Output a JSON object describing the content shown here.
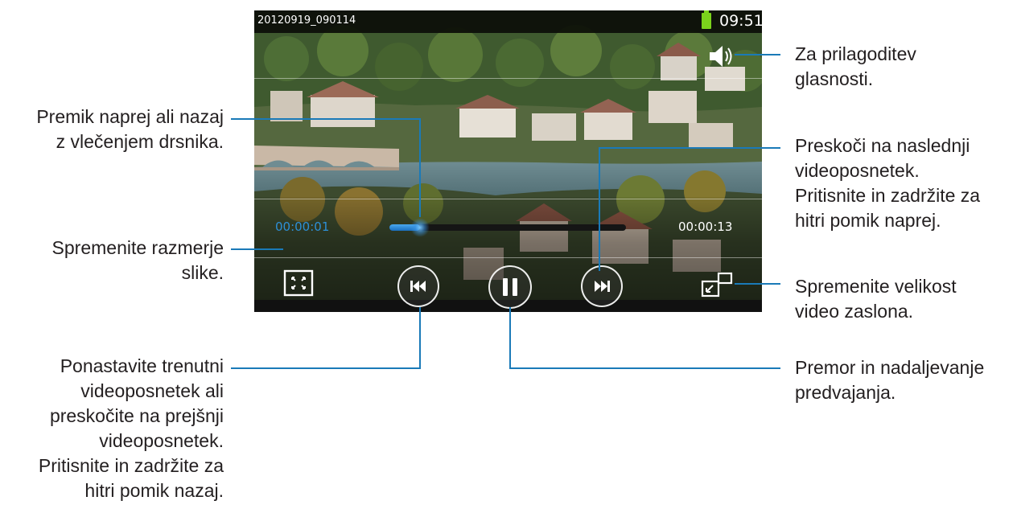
{
  "status_bar": {
    "file_name": "20120919_090114",
    "time": "09:51"
  },
  "player": {
    "current_time": "00:00:01",
    "total_time": "00:00:13",
    "progress": 0.13,
    "accent_color": "#2d8fd6"
  },
  "icons": {
    "volume": "speaker-icon",
    "aspect": "aspect-ratio-icon",
    "previous": "skip-previous-icon",
    "play_pause": "pause-icon",
    "next": "skip-next-icon",
    "resize": "popup-window-icon",
    "battery": "battery-icon"
  },
  "callouts": {
    "volume": "Za prilagoditev\nglasnosti.",
    "seek": "Premik naprej ali nazaj\nz vlečenjem drsnika.",
    "next": "Preskoči na naslednji\nvideoposnetek.\nPritisnite in zadržite za\nhitri pomik naprej.",
    "aspect": "Spremenite razmerje\nslike.",
    "resize": "Spremenite velikost\nvideo zaslona.",
    "previous": "Ponastavite trenutni\nvideoposnetek ali\npreskočite na prejšnji\nvideoposnetek.\nPritisnite in zadržite za\nhitri pomik nazaj.",
    "pause": "Premor in nadaljevanje\npredvajanja."
  }
}
